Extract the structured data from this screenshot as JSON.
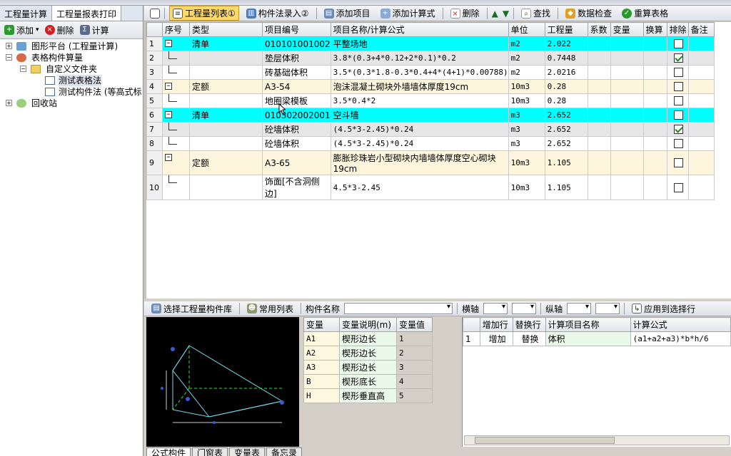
{
  "left_panel": {
    "tabs": [
      "工程量计算",
      "工程量报表打印"
    ],
    "toolbar": {
      "add": "添加",
      "delete": "删除",
      "calc": "计算"
    },
    "tree": [
      {
        "label": "图形平台 (工程量计算)",
        "level": 0
      },
      {
        "label": "表格构件算量",
        "level": 0
      },
      {
        "label": "自定义文件夹",
        "level": 1
      },
      {
        "label": "测试表格法",
        "level": 2
      },
      {
        "label": "测试构件法 (等高式标",
        "level": 2
      },
      {
        "label": "回收站",
        "level": 0
      }
    ]
  },
  "main_toolbar": {
    "list": "工程量列表①",
    "component_entry": "构件法录入②",
    "add_item": "添加项目",
    "add_formula": "添加计算式",
    "delete": "删除",
    "find": "查找",
    "check": "数据检查",
    "recalc": "重算表格"
  },
  "grid": {
    "columns": [
      "序号",
      "类型",
      "项目编号",
      "项目名称/计算公式",
      "单位",
      "工程量",
      "系数",
      "变量",
      "换算",
      "排除",
      "备注"
    ],
    "rows": [
      {
        "no": "1",
        "type": "清单",
        "code": "010101001002",
        "name": "平整场地",
        "unit": "m2",
        "qty": "2.022",
        "excl": false,
        "style": "qd",
        "tree": "box"
      },
      {
        "no": "2",
        "type": "",
        "code": "垫层体积",
        "name": "3.8*(0.3+4*0.12+2*0.1)*0.2",
        "unit": "m2",
        "qty": "0.7448",
        "excl": true,
        "style": "gr",
        "tree": "leaf"
      },
      {
        "no": "3",
        "type": "",
        "code": "砖基础体积",
        "name": "3.5*(0.3*1.8-0.3*0.4+4*(4+1)*0.00788)",
        "unit": "m2",
        "qty": "2.0216",
        "excl": false,
        "style": "wh",
        "tree": "leaf"
      },
      {
        "no": "4",
        "type": "定额",
        "code": "A3-54",
        "name": "泡沫混凝土砌块外墙墙体厚度19cm",
        "unit": "10m3",
        "qty": "0.28",
        "excl": false,
        "style": "de",
        "tree": "box"
      },
      {
        "no": "5",
        "type": "",
        "code": "地圈梁模板",
        "name": "3.5*0.4*2",
        "unit": "10m3",
        "qty": "0.28",
        "excl": false,
        "style": "wh",
        "tree": "leaf"
      },
      {
        "no": "6",
        "type": "清单",
        "code": "010302002001",
        "name": "空斗墙",
        "unit": "m3",
        "qty": "2.652",
        "excl": false,
        "style": "qd",
        "tree": "box"
      },
      {
        "no": "7",
        "type": "",
        "code": "砼墙体积",
        "name": "(4.5*3-2.45)*0.24",
        "unit": "m3",
        "qty": "2.652",
        "excl": true,
        "style": "gr",
        "tree": "leaf"
      },
      {
        "no": "8",
        "type": "",
        "code": "砼墙体积",
        "name": "(4.5*3-2.45)*0.24",
        "unit": "m3",
        "qty": "2.652",
        "excl": false,
        "style": "wh",
        "tree": "leaf"
      },
      {
        "no": "9",
        "type": "定额",
        "code": "A3-65",
        "name": "膨胀珍珠岩小型砌块内墙墙体厚度空心砌块19cm",
        "unit": "10m3",
        "qty": "1.105",
        "excl": false,
        "style": "de tall",
        "tree": "box"
      },
      {
        "no": "10",
        "type": "",
        "code": "饰面[不含洞侧边]",
        "name": "4.5*3-2.45",
        "unit": "10m3",
        "qty": "1.105",
        "excl": false,
        "style": "wh tall",
        "tree": "leaf"
      }
    ]
  },
  "bottom_toolbar": {
    "select_lib": "选择工程量构件库",
    "common_list": "常用列表",
    "component_name": "构件名称",
    "h_axis": "横轴",
    "v_axis": "纵轴",
    "apply": "应用到选择行"
  },
  "var_table": {
    "columns": [
      "变量",
      "变量说明(m)",
      "变量值"
    ],
    "rows": [
      {
        "var": "A1",
        "desc": "楔形边长",
        "val": "1"
      },
      {
        "var": "A2",
        "desc": "楔形边长",
        "val": "2"
      },
      {
        "var": "A3",
        "desc": "楔形边长",
        "val": "3"
      },
      {
        "var": "B",
        "desc": "楔形底长",
        "val": "4"
      },
      {
        "var": "H",
        "desc": "楔形垂直高",
        "val": "5"
      }
    ]
  },
  "formula_table": {
    "columns": [
      "",
      "增加行",
      "替换行",
      "计算项目名称",
      "计算公式"
    ],
    "rows": [
      {
        "no": "1",
        "add": "增加",
        "replace": "替换",
        "name": "体积",
        "formula": "(a1+a2+a3)*b*h/6"
      }
    ]
  },
  "bottom_tabs": [
    "公式构件",
    "门窗表",
    "变量表",
    "备忘录"
  ],
  "colors": {
    "qingdan_row": "#00ffff",
    "dinge_row": "#fdf5dc",
    "active_tab": "#ffd86a"
  }
}
